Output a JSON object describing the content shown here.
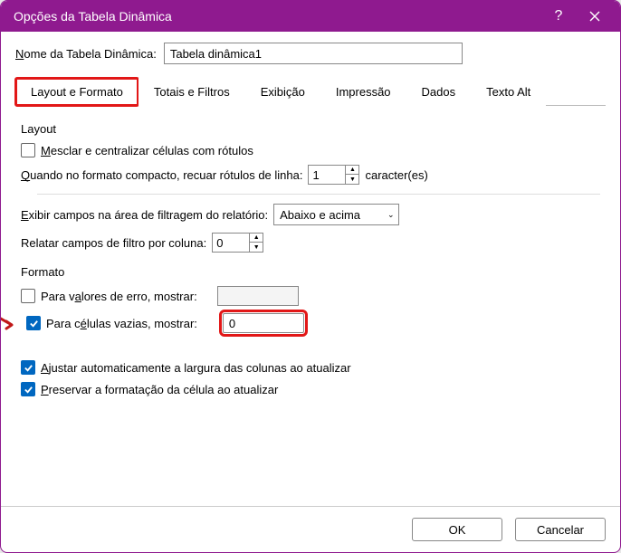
{
  "title": "Opções da Tabela Dinâmica",
  "name_label_pre": "N",
  "name_label_post": "ome da Tabela Dinâmica:",
  "name_value": "Tabela dinâmica1",
  "tabs": {
    "layout": "Layout e Formato",
    "totals": "Totais e Filtros",
    "display": "Exibição",
    "print": "Impressão",
    "data": "Dados",
    "alt": "Texto Alt"
  },
  "group_layout": "Layout",
  "merge_pre": "M",
  "merge_post": "esclar e centralizar células com rótulos",
  "indent_pre": "Q",
  "indent_post": "uando no formato compacto, recuar rótulos de linha:",
  "indent_value": "1",
  "indent_unit": "caracter(es)",
  "showfields_pre": "E",
  "showfields_post": "xibir campos na área de filtragem do relatório:",
  "showfields_value": "Abaixo e acima",
  "report_label": "Relatar campos de filtro por coluna:",
  "report_value": "0",
  "group_format": "Formato",
  "err_pre": "Para v",
  "err_u": "a",
  "err_post": "lores de erro, mostrar:",
  "empty_pre": "Para c",
  "empty_u": "é",
  "empty_post": "lulas vazias, mostrar:",
  "empty_value": "0",
  "autofit_pre": "A",
  "autofit_post": "justar automaticamente a largura das colunas ao atualizar",
  "preserve_pre": "P",
  "preserve_post": "reservar a formatação da célula ao atualizar",
  "ok": "OK",
  "cancel": "Cancelar"
}
